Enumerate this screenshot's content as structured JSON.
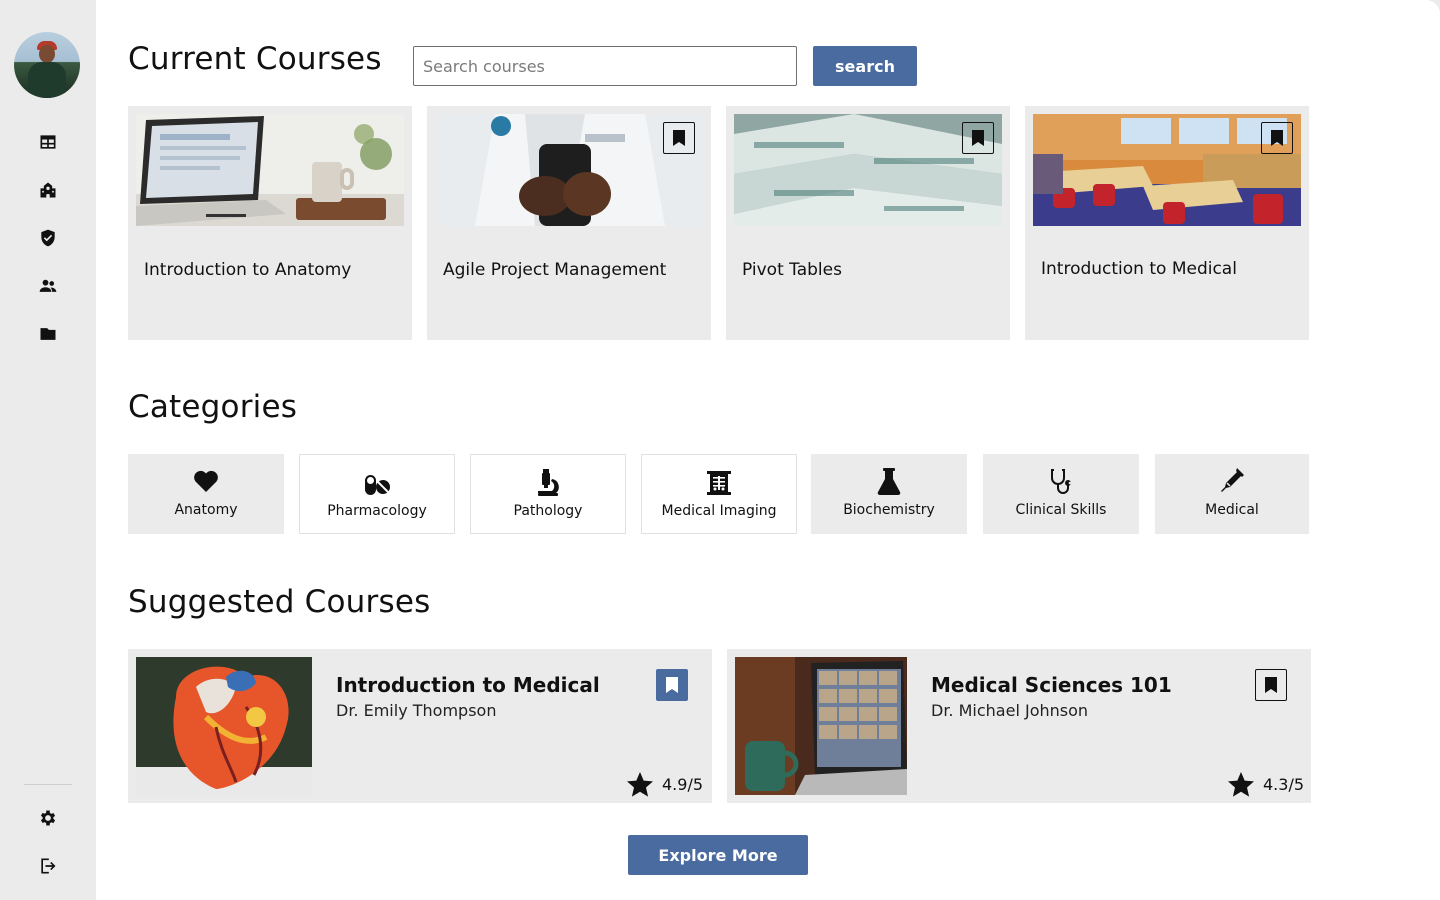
{
  "sidebar": {
    "avatar": "user-avatar",
    "nav": [
      {
        "icon": "dashboard-icon"
      },
      {
        "icon": "school-icon"
      },
      {
        "icon": "shield-check-icon"
      },
      {
        "icon": "people-icon"
      },
      {
        "icon": "folder-icon"
      }
    ],
    "bottom": [
      {
        "icon": "gear-icon"
      },
      {
        "icon": "logout-icon"
      }
    ]
  },
  "current_courses": {
    "heading": "Current Courses",
    "search_placeholder": "Search courses",
    "search_label": "search",
    "courses": [
      {
        "title": "Introduction to Anatomy",
        "image": "laptop-desk-photo",
        "bookmark": "none"
      },
      {
        "title": "Agile Project Management",
        "image": "doctor-phone-photo",
        "bookmark": "outline"
      },
      {
        "title": "Pivot Tables",
        "image": "medical-supplies-photo",
        "bookmark": "outline"
      },
      {
        "title": "Introduction to Medical",
        "image": "classroom-photo",
        "bookmark": "outline"
      }
    ]
  },
  "categories": {
    "heading": "Categories",
    "items": [
      {
        "label": "Anatomy",
        "icon": "heart-icon"
      },
      {
        "label": "Pharmacology",
        "icon": "pills-icon"
      },
      {
        "label": "Pathology",
        "icon": "microscope-icon"
      },
      {
        "label": "Medical Imaging",
        "icon": "x-ray-icon"
      },
      {
        "label": "Biochemistry",
        "icon": "flask-icon"
      },
      {
        "label": "Clinical Skills",
        "icon": "stethoscope-icon"
      },
      {
        "label": "Medical",
        "icon": "syringe-icon"
      }
    ]
  },
  "suggested": {
    "heading": "Suggested Courses",
    "courses": [
      {
        "title": "Introduction to Medical",
        "author": "Dr. Emily Thompson",
        "rating": "4.9/5",
        "image": "heart-model-photo",
        "bookmark": "filled"
      },
      {
        "title": "Medical Sciences 101",
        "author": "Dr. Michael Johnson",
        "rating": "4.3/5",
        "image": "video-call-laptop-photo",
        "bookmark": "outline"
      }
    ],
    "explore_label": "Explore More"
  },
  "colors": {
    "accent": "#4a6b9f",
    "card_bg": "#ebebeb",
    "sidebar_bg": "#ebebeb"
  }
}
